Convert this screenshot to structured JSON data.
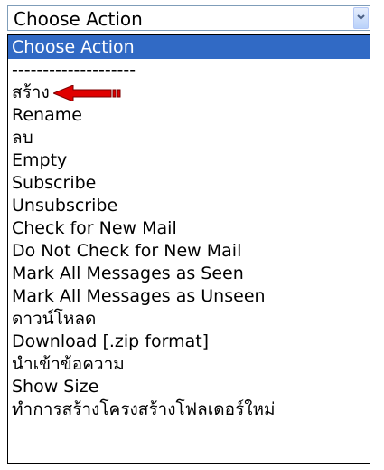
{
  "select": {
    "value": "Choose Action"
  },
  "options": [
    {
      "label": "Choose Action",
      "selected": true
    },
    {
      "label": "--------------------"
    },
    {
      "label": "สร้าง"
    },
    {
      "label": "Rename"
    },
    {
      "label": "ลบ"
    },
    {
      "label": "Empty"
    },
    {
      "label": "Subscribe"
    },
    {
      "label": "Unsubscribe"
    },
    {
      "label": "Check for New Mail"
    },
    {
      "label": "Do Not Check for New Mail"
    },
    {
      "label": "Mark All Messages as Seen"
    },
    {
      "label": "Mark All Messages as Unseen"
    },
    {
      "label": "ดาวน์โหลด"
    },
    {
      "label": "Download [.zip format]"
    },
    {
      "label": "นำเข้าข้อความ"
    },
    {
      "label": "Show Size"
    },
    {
      "label": "ทำการสร้างโครงสร้างโฟลเดอร์ใหม่"
    }
  ],
  "colors": {
    "selected_bg": "#316ac5",
    "annotation_arrow": "#e00000"
  },
  "icons": {
    "dropdown": "chevron-down-icon",
    "annotation": "red-arrow-icon"
  }
}
